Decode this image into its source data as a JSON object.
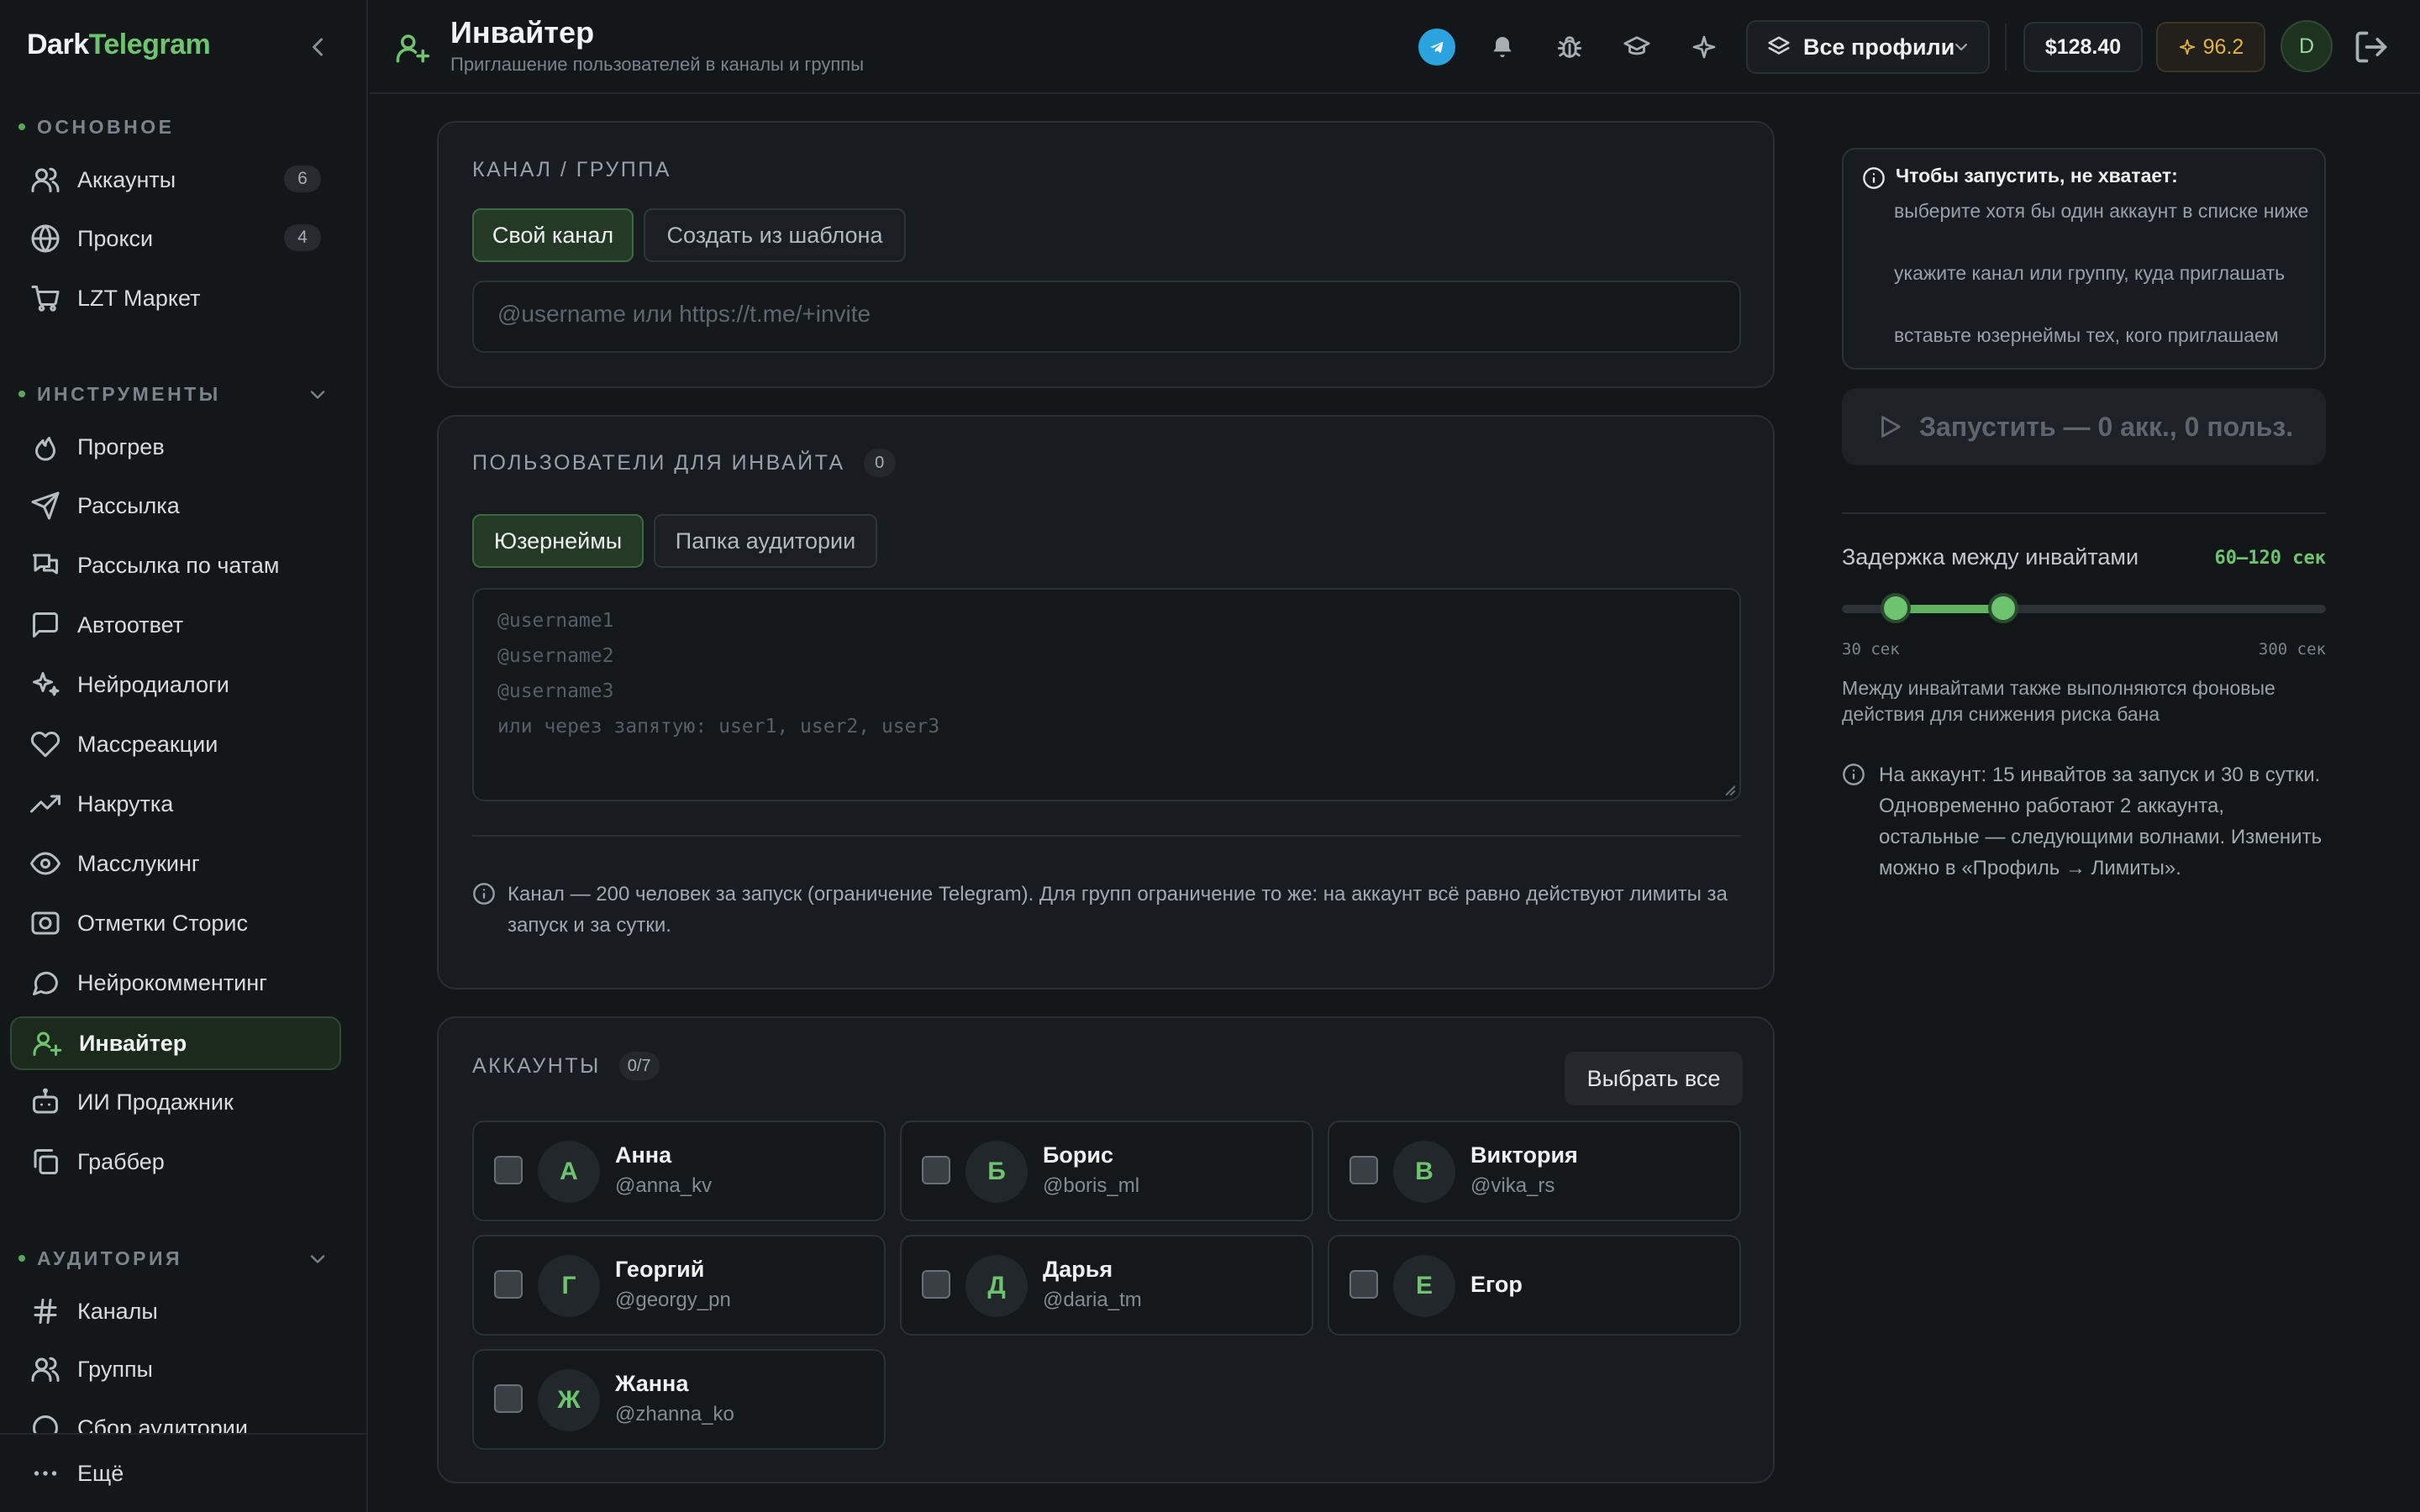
{
  "brand": {
    "part1": "Dark",
    "part2": "Telegram"
  },
  "sidebar": {
    "sections": [
      {
        "title": "ОСНОВНОЕ"
      },
      {
        "title": "ИНСТРУМЕНТЫ"
      },
      {
        "title": "АУДИТОРИЯ"
      }
    ],
    "main_items": [
      {
        "label": "Аккаунты",
        "count": "6",
        "icon": "users-icon"
      },
      {
        "label": "Прокси",
        "count": "4",
        "icon": "globe-icon"
      },
      {
        "label": "LZT Маркет",
        "icon": "cart-icon"
      }
    ],
    "tools_items": [
      {
        "label": "Прогрев",
        "icon": "flame-icon"
      },
      {
        "label": "Рассылка",
        "icon": "send-icon"
      },
      {
        "label": "Рассылка по чатам",
        "icon": "chats-icon"
      },
      {
        "label": "Автоответ",
        "icon": "message-square-icon"
      },
      {
        "label": "Нейродиалоги",
        "icon": "sparkles-icon"
      },
      {
        "label": "Массреакции",
        "icon": "heart-icon"
      },
      {
        "label": "Накрутка",
        "icon": "trending-up-icon"
      },
      {
        "label": "Масслукинг",
        "icon": "eye-icon"
      },
      {
        "label": "Отметки Сторис",
        "icon": "camera-icon"
      },
      {
        "label": "Нейрокомментинг",
        "icon": "message-circle-icon"
      },
      {
        "label": "Инвайтер",
        "icon": "user-plus-icon",
        "active": true
      },
      {
        "label": "ИИ Продажник",
        "icon": "bot-icon"
      },
      {
        "label": "Граббер",
        "icon": "copy-icon"
      }
    ],
    "audience_items": [
      {
        "label": "Каналы",
        "icon": "hash-icon"
      },
      {
        "label": "Группы",
        "icon": "users-icon"
      },
      {
        "label": "Сбор аудитории",
        "icon": "circle-icon"
      }
    ],
    "more_label": "Ещё"
  },
  "header": {
    "title": "Инвайтер",
    "subtitle": "Приглашение пользователей в каналы и группы",
    "profiles_label": "Все профили",
    "balance": "$128.40",
    "rating": "96.2",
    "avatar_letter": "D"
  },
  "channel_card": {
    "label": "КАНАЛ / ГРУППА",
    "tabs": [
      "Свой канал",
      "Создать из шаблона"
    ],
    "input_placeholder": "@username или https://t.me/+invite"
  },
  "users_card": {
    "label": "ПОЛЬЗОВАТЕЛИ ДЛЯ ИНВАЙТА",
    "count": "0",
    "tabs": [
      "Юзернеймы",
      "Папка аудитории"
    ],
    "placeholder_lines": [
      "@username1",
      "@username2",
      "@username3",
      "или через запятую: user1, user2, user3"
    ],
    "note": "Канал — 200 человек за запуск (ограничение Telegram). Для групп ограничение то же: на аккаунт всё равно действуют лимиты за запуск и за сутки."
  },
  "accounts_card": {
    "label": "АККАУНТЫ",
    "count": "0/7",
    "select_all": "Выбрать все",
    "accounts": [
      {
        "letter": "А",
        "name": "Анна",
        "username": "@anna_kv"
      },
      {
        "letter": "Б",
        "name": "Борис",
        "username": "@boris_ml"
      },
      {
        "letter": "В",
        "name": "Виктория",
        "username": "@vika_rs"
      },
      {
        "letter": "Г",
        "name": "Георгий",
        "username": "@georgy_pn"
      },
      {
        "letter": "Д",
        "name": "Дарья",
        "username": "@daria_tm"
      },
      {
        "letter": "Е",
        "name": "Егор",
        "username": ""
      },
      {
        "letter": "Ж",
        "name": "Жанна",
        "username": "@zhanna_ko"
      }
    ]
  },
  "right_panel": {
    "warning_title": "Чтобы запустить, не хватает:",
    "warning_items": [
      "выберите хотя бы один аккаунт в списке ниже",
      "укажите канал или группу, куда приглашать",
      "вставьте юзернеймы тех, кого приглашаем"
    ],
    "run_label": "Запустить — 0 акк., 0 польз.",
    "delay_label": "Задержка между инвайтами",
    "delay_value": "60–120 сек",
    "slider": {
      "min": 30,
      "max": 300,
      "low": 60,
      "high": 120,
      "min_label": "30 сек",
      "max_label": "300 сек"
    },
    "delay_note": "Между инвайтами также выполняются фоновые действия для снижения риска бана",
    "limits_note": "На аккаунт: 15 инвайтов за запуск и 30 в сутки. Одновременно работают 2 аккаунта, остальные — следующими волнами. Изменить можно в «Профиль → Лимиты»."
  },
  "colors": {
    "accent": "#6ec46e",
    "background": "#131619",
    "card": "#181b1f",
    "telegram": "#2aa3de",
    "rating": "#e3b341"
  }
}
